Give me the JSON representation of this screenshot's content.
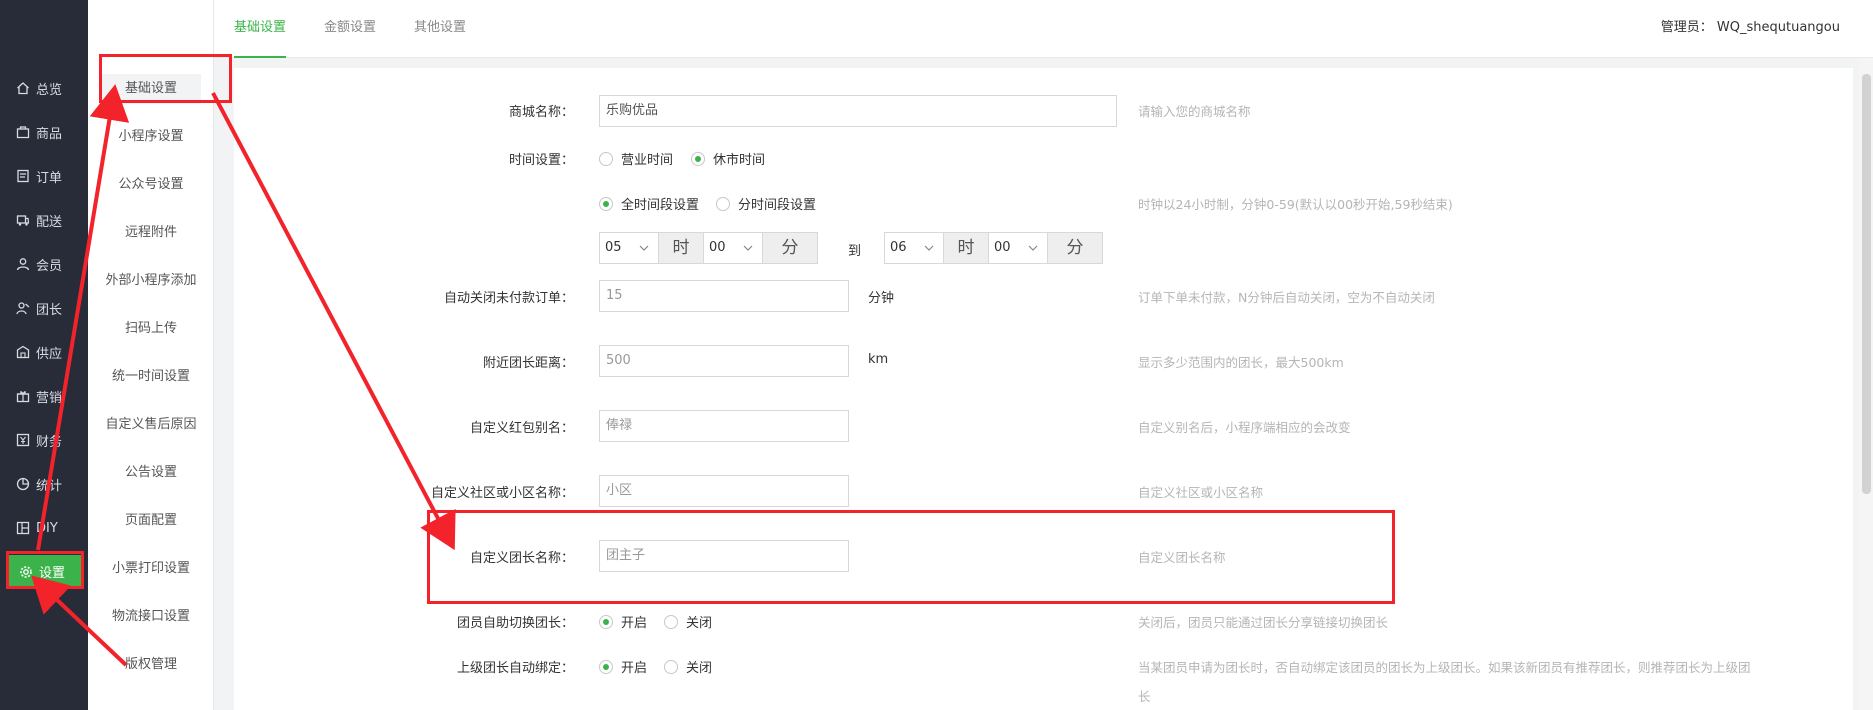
{
  "nav": {
    "items": [
      {
        "label": "总览",
        "icon": "home-icon"
      },
      {
        "label": "商品",
        "icon": "goods-icon"
      },
      {
        "label": "订单",
        "icon": "order-icon"
      },
      {
        "label": "配送",
        "icon": "delivery-icon"
      },
      {
        "label": "会员",
        "icon": "member-icon"
      },
      {
        "label": "团长",
        "icon": "leader-icon"
      },
      {
        "label": "供应",
        "icon": "supply-icon"
      },
      {
        "label": "营销",
        "icon": "gift-icon"
      },
      {
        "label": "财务",
        "icon": "finance-icon"
      },
      {
        "label": "统计",
        "icon": "pie-chart-icon"
      },
      {
        "label": "DIY",
        "icon": "layout-icon"
      },
      {
        "label": "设置",
        "icon": "gear-icon"
      }
    ],
    "active": "设置"
  },
  "submenu": {
    "items": [
      "基础设置",
      "小程序设置",
      "公众号设置",
      "远程附件",
      "外部小程序添加",
      "扫码上传",
      "统一时间设置",
      "自定义售后原因",
      "公告设置",
      "页面配置",
      "小票打印设置",
      "物流接口设置",
      "版权管理"
    ],
    "active": "基础设置"
  },
  "tabs": [
    "基础设置",
    "金额设置",
    "其他设置"
  ],
  "admin": "管理员： WQ_shequtuangou",
  "form": {
    "shop_name": {
      "label": "商城名称：",
      "value": "乐购优品",
      "hint": "请输入您的商城名称"
    },
    "time_setting": {
      "label": "时间设置：",
      "options": [
        "营业时间",
        "休市时间"
      ],
      "selected": "休市时间"
    },
    "period": {
      "options": [
        "全时间段设置",
        "分时间段设置"
      ],
      "selected": "全时间段设置",
      "hint": "时钟以24小时制，分钟0-59(默认以00秒开始,59秒结束)"
    },
    "time_range": {
      "start_hour": "05",
      "start_min": "00",
      "end_hour": "06",
      "end_min": "00",
      "hour_addon": "时",
      "min_addon": "分",
      "to": "到"
    },
    "auto_close": {
      "label": "自动关闭未付款订单：",
      "value": "15",
      "unit": "分钟",
      "hint": "订单下单未付款，N分钟后自动关闭，空为不自动关闭"
    },
    "nearby_distance": {
      "label": "附近团长距离：",
      "value": "500",
      "unit": "km",
      "hint": "显示多少范围内的团长，最大500km"
    },
    "redpacket_alias": {
      "label": "自定义红包别名：",
      "value": "俸禄",
      "hint": "自定义别名后，小程序端相应的会改变"
    },
    "community_name": {
      "label": "自定义社区或小区名称：",
      "value": "小区",
      "hint": "自定义社区或小区名称"
    },
    "leader_name": {
      "label": "自定义团长名称：",
      "value": "团主子",
      "hint": "自定义团长名称"
    },
    "self_switch": {
      "label": "团员自助切换团长：",
      "options": [
        "开启",
        "关闭"
      ],
      "selected": "开启",
      "hint": "关闭后，团员只能通过团长分享链接切换团长"
    },
    "auto_bind": {
      "label": "上级团长自动绑定：",
      "options": [
        "开启",
        "关闭"
      ],
      "selected": "开启",
      "hint": "当某团员申请为团长时，否自动绑定该团员的团长为上级团长。如果该新团员有推荐团长，则推荐团长为上级团",
      "hint2": "长"
    }
  },
  "colors": {
    "accent": "#3cb34a",
    "nav_bg": "#282b38",
    "annotation": "#f2232a"
  }
}
